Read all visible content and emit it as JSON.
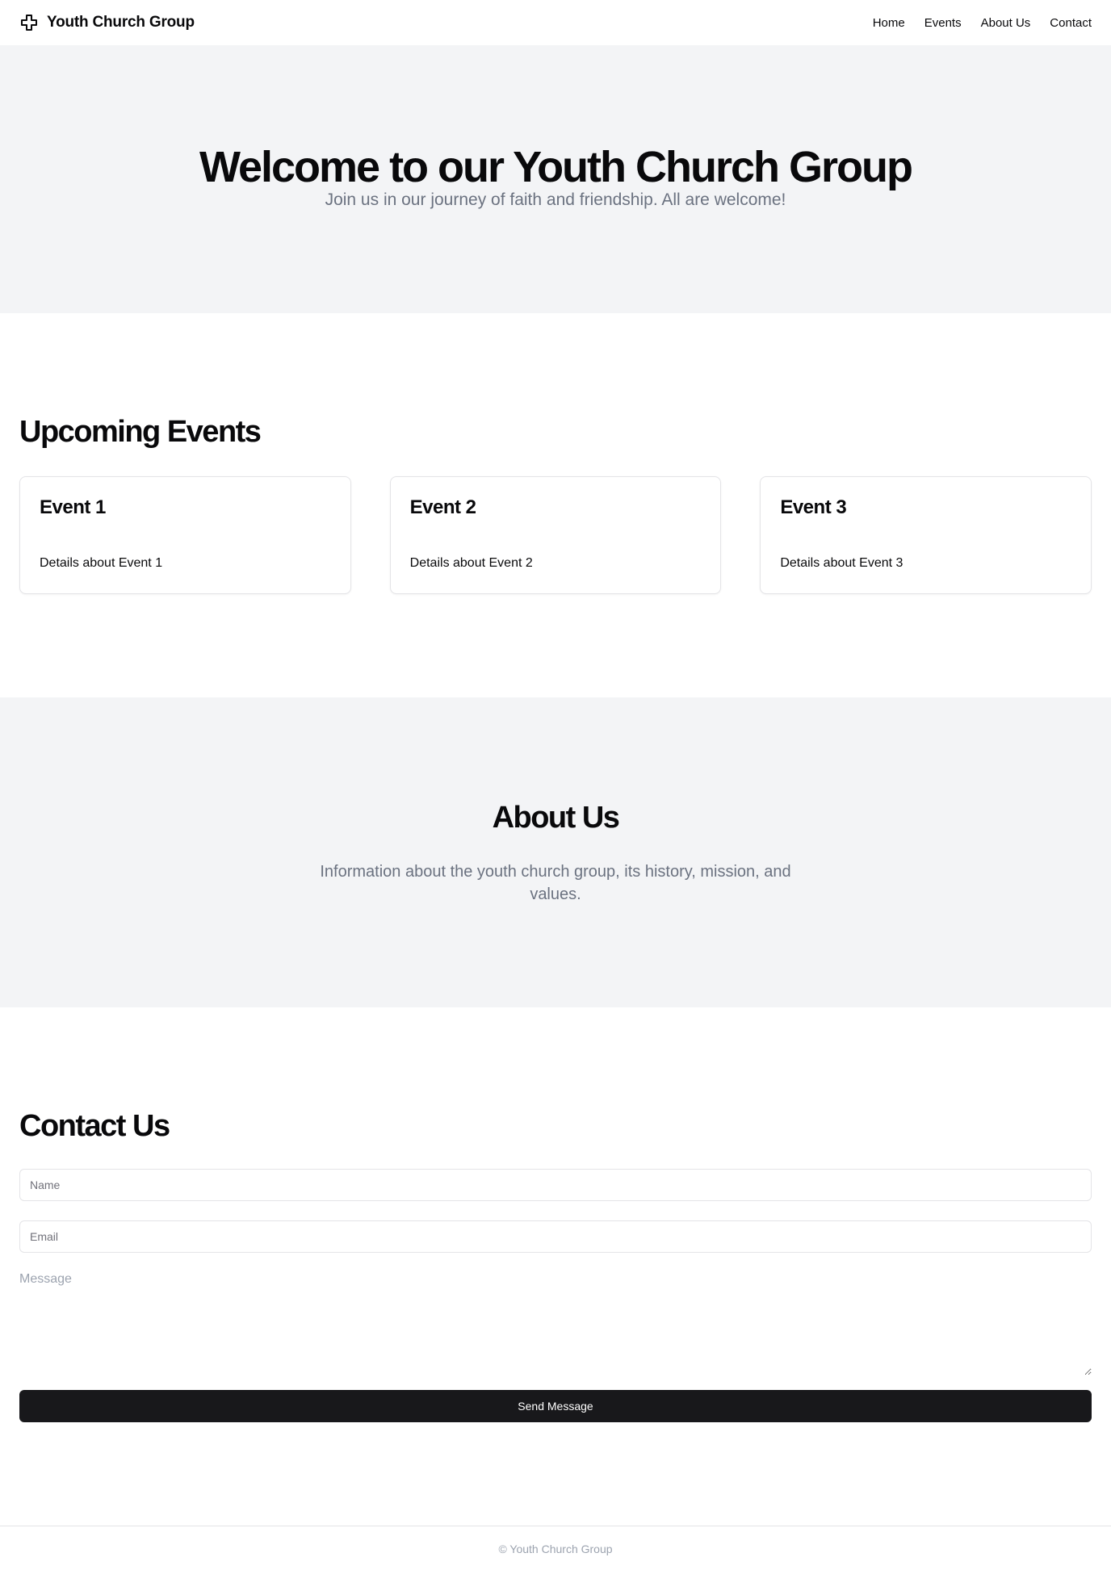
{
  "header": {
    "brand_icon": "cross-icon",
    "brand_name": "Youth Church Group",
    "nav": [
      {
        "label": "Home"
      },
      {
        "label": "Events"
      },
      {
        "label": "About Us"
      },
      {
        "label": "Contact"
      }
    ]
  },
  "hero": {
    "title": "Welcome to our Youth Church Group",
    "subtitle": "Join us in our journey of faith and friendship. All are welcome!"
  },
  "events": {
    "title": "Upcoming Events",
    "cards": [
      {
        "title": "Event 1",
        "description": "Details about Event 1"
      },
      {
        "title": "Event 2",
        "description": "Details about Event 2"
      },
      {
        "title": "Event 3",
        "description": "Details about Event 3"
      }
    ]
  },
  "about": {
    "title": "About Us",
    "text": "Information about the youth church group, its history, mission, and values."
  },
  "contact": {
    "title": "Contact Us",
    "name_placeholder": "Name",
    "email_placeholder": "Email",
    "message_placeholder": "Message",
    "submit_label": "Send Message"
  },
  "footer": {
    "text": "© Youth Church Group"
  },
  "colors": {
    "section_bg": "#f3f4f6",
    "button_bg": "#18181b",
    "muted_text": "#6b7280",
    "border": "#e4e4e7"
  }
}
